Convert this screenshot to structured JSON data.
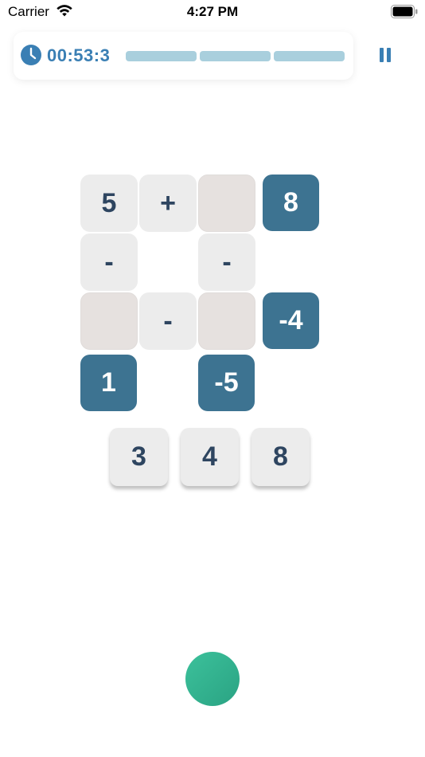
{
  "status_bar": {
    "carrier": "Carrier",
    "time": "4:27 PM",
    "icons": [
      "wifi-icon",
      "battery-icon"
    ]
  },
  "timer": {
    "value": "00:53:3",
    "icon": "clock-icon",
    "color": "#3a7fb4",
    "progress_segments": 3,
    "progress_color": "#a9cfdd"
  },
  "pause": {
    "icon": "pause-icon"
  },
  "grid": {
    "row1": {
      "a": "5",
      "op": "+",
      "b": "",
      "result": "8"
    },
    "col_ops": {
      "left": "-",
      "right": "-"
    },
    "row3": {
      "a": "",
      "op": "-",
      "b": "",
      "result": "-4"
    },
    "col_results": {
      "left": "1",
      "right": "-5"
    }
  },
  "bank": {
    "tiles": [
      "3",
      "4",
      "8"
    ]
  },
  "colors": {
    "tile_gray": "#ececec",
    "tile_empty": "#e6e1df",
    "tile_result": "#3d7391",
    "text_dark": "#2e4560",
    "submit_green": "#3cc19b"
  }
}
